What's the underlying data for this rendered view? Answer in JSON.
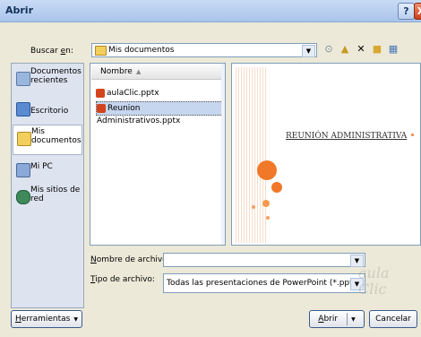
{
  "title": "Abrir",
  "titlebar": {
    "help": "?",
    "close": "X"
  },
  "lookin": {
    "label_pre": "Buscar ",
    "label_u": "e",
    "label_post": "n:",
    "value": "Mis documentos"
  },
  "toolbar_icons": [
    "back-icon",
    "up-folder-icon",
    "delete-icon",
    "new-folder-icon",
    "views-icon"
  ],
  "places": [
    {
      "label": "Documentos recientes",
      "icon": "recent-documents-icon"
    },
    {
      "label": "Escritorio",
      "icon": "desktop-icon"
    },
    {
      "label": "Mis documentos",
      "icon": "my-documents-icon",
      "selected": true
    },
    {
      "label": "Mi PC",
      "icon": "my-computer-icon"
    },
    {
      "label": "Mis sitios de red",
      "icon": "network-places-icon"
    }
  ],
  "filelist": {
    "column": "Nombre",
    "files": [
      {
        "name": "aulaClic.pptx",
        "selected": false
      },
      {
        "name": "Reunion Administrativos.pptx",
        "selected": true
      }
    ]
  },
  "preview": {
    "slide_title": "REUNIÓN ADMINISTRATIVA"
  },
  "filename": {
    "label_u": "N",
    "label_rest": "ombre de archivo:",
    "value": ""
  },
  "filetype": {
    "label_u": "T",
    "label_rest": "ipo de archivo:",
    "value": "Todas las presentaciones de PowerPoint (*.pptx;*.ppt"
  },
  "buttons": {
    "tools_u": "H",
    "tools_rest": "erramientas",
    "open_u": "A",
    "open_rest": "brir",
    "cancel": "Cancelar"
  },
  "watermark": "aula Clic"
}
